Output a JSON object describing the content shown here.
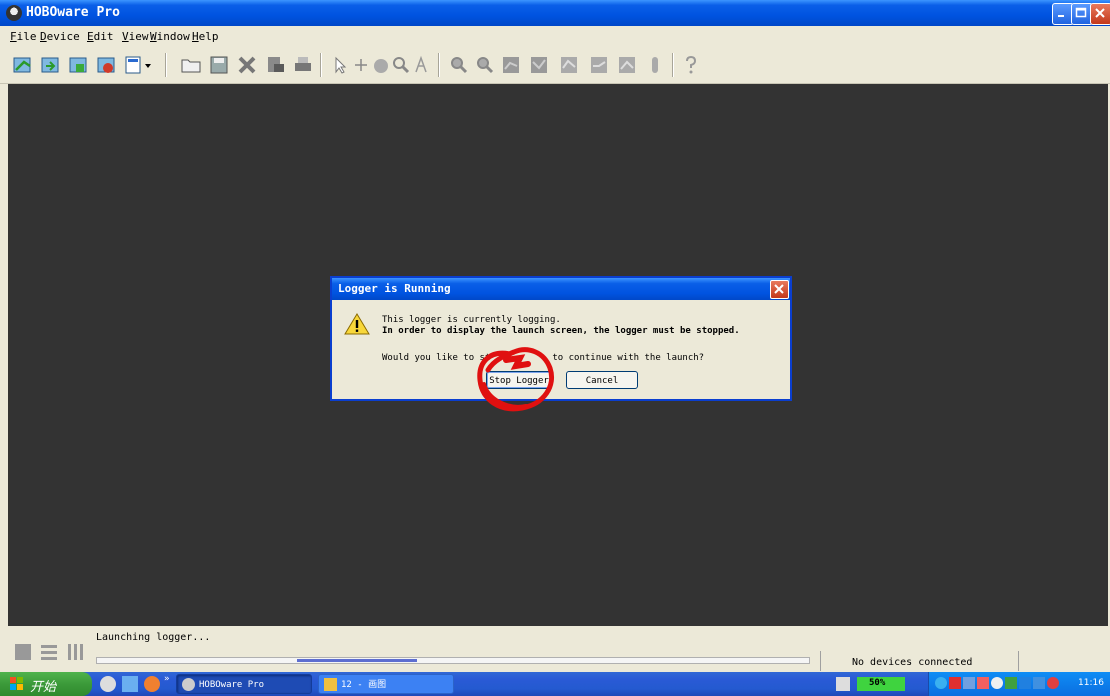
{
  "window": {
    "title": "HOBOware Pro",
    "accent_color": "#0053e0",
    "workspace_color": "#333333"
  },
  "menu": {
    "items": [
      {
        "underline": "F",
        "rest": "ile"
      },
      {
        "underline": "D",
        "rest": "evice"
      },
      {
        "underline": "E",
        "rest": "dit"
      },
      {
        "underline": "V",
        "rest": "iew"
      },
      {
        "underline": "W",
        "rest": "indow"
      },
      {
        "underline": "H",
        "rest": "elp"
      }
    ]
  },
  "toolbar": {
    "icons": [
      "launch-icon",
      "readout-icon",
      "download-icon",
      "stop-icon",
      "device-dropdown-icon",
      "open-icon",
      "save-icon",
      "delete-icon",
      "export-icon",
      "print-icon",
      "pointer-icon",
      "crosshair-icon",
      "hand-icon",
      "zoom-icon",
      "label-icon",
      "zoom-in-icon",
      "zoom-out-icon",
      "plot-icon-1",
      "plot-icon-2",
      "plot-icon-3",
      "plot-icon-4",
      "plot-icon-5",
      "thermometer-icon",
      "help-icon"
    ]
  },
  "dialog": {
    "title": "Logger is Running",
    "line1": "This logger is currently logging.",
    "line2": "In order to display the launch screen, the logger must be stopped.",
    "line3_start": "Would you like to st",
    "line3_end": "to continue with the launch?",
    "stop_button": "Stop Logger",
    "cancel_button": "Cancel"
  },
  "status": {
    "message": "Launching logger...",
    "devices": "No devices connected",
    "progress_percent": 28
  },
  "taskbar": {
    "start_label": "开始",
    "tasks": [
      {
        "label": "HOBOware Pro"
      },
      {
        "label": "12 - 画图"
      }
    ],
    "battery": "50%",
    "clock": "11:16"
  }
}
